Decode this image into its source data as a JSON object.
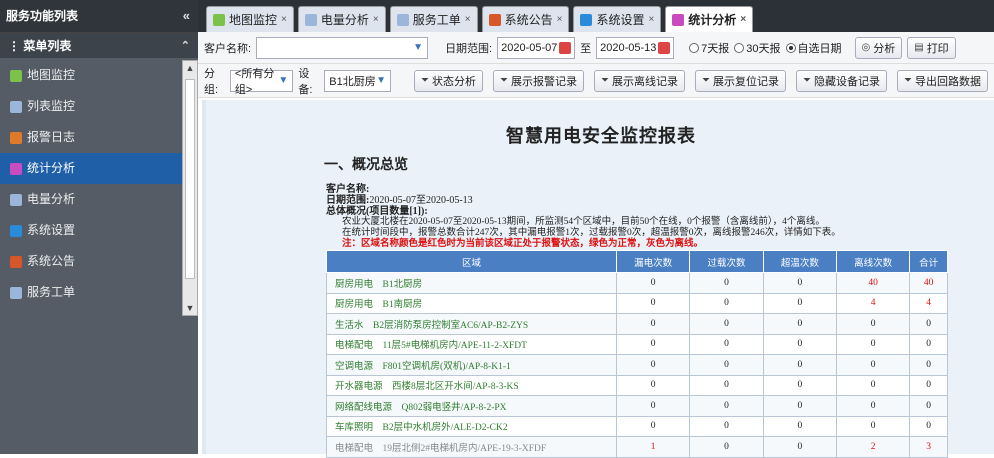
{
  "left": {
    "title": "服务功能列表",
    "collapse": "«",
    "menu_head": "菜单列表",
    "menu_toggle": "⌃",
    "items": [
      {
        "label": "地图监控",
        "icon": "map-icon",
        "color": "#7cc24a"
      },
      {
        "label": "列表监控",
        "icon": "list-icon",
        "color": "#9bb6d8"
      },
      {
        "label": "报警日志",
        "icon": "alarm-log-icon",
        "color": "#e07a2a"
      },
      {
        "label": "统计分析",
        "icon": "statistics-icon",
        "color": "#c84cc0",
        "active": true
      },
      {
        "label": "电量分析",
        "icon": "power-icon",
        "color": "#9bb6d8"
      },
      {
        "label": "系统设置",
        "icon": "settings-icon",
        "color": "#2a8bd8"
      },
      {
        "label": "系统公告",
        "icon": "notice-icon",
        "color": "#d8572a"
      },
      {
        "label": "服务工单",
        "icon": "workorder-icon",
        "color": "#9bb6d8"
      }
    ]
  },
  "tabs": [
    {
      "label": "地图监控",
      "icon": "map-icon",
      "color": "#7cc24a"
    },
    {
      "label": "电量分析",
      "icon": "power-icon",
      "color": "#9bb6d8"
    },
    {
      "label": "服务工单",
      "icon": "workorder-icon",
      "color": "#9bb6d8"
    },
    {
      "label": "系统公告",
      "icon": "notice-icon",
      "color": "#d8572a"
    },
    {
      "label": "系统设置",
      "icon": "settings-icon",
      "color": "#2a8bd8"
    },
    {
      "label": "统计分析",
      "icon": "statistics-icon",
      "color": "#c84cc0",
      "active": true
    }
  ],
  "toolbar1": {
    "customer_label": "客户名称:",
    "date_label": "日期范围:",
    "date_from": "2020-05-07",
    "date_to_sep": "至",
    "date_to": "2020-05-13",
    "radio_7": "7天报",
    "radio_30": "30天报",
    "radio_custom": "自选日期",
    "analyze": "分析",
    "print": "打印"
  },
  "toolbar2": {
    "group_label": "分组:",
    "group_value": "<所有分组>",
    "device_label": "设备:",
    "device_value": "B1北厨房",
    "buttons": [
      "状态分析",
      "展示报警记录",
      "展示离线记录",
      "展示复位记录",
      "隐藏设备记录",
      "导出回路数据"
    ]
  },
  "report": {
    "title": "智慧用电安全监控报表",
    "section": "一、概况总览",
    "customer_label": "客户名称:",
    "date_range_label": "日期范围:",
    "date_range": "2020-05-07至2020-05-13",
    "summary_label": "总体概况(项目数量[1]):",
    "line1": "农业大厦北楼在2020-05-07至2020-05-13期间，所监测54个区域中，目前50个在线，0个报警（含离线前），4个离线。",
    "line2": "在统计时间段中，报警总数合计247次，其中漏电报警1次，过载报警0次，超温报警0次，离线报警246次，详情如下表。",
    "warning": "注：区域名称颜色是红色时为当前该区域正处于报警状态，绿色为正常，灰色为离线。"
  },
  "table": {
    "headers": [
      "区域",
      "漏电次数",
      "过载次数",
      "超温次数",
      "离线次数",
      "合计"
    ],
    "rows": [
      {
        "area": "厨房用电　B1北厨房",
        "v": [
          "0",
          "0",
          "0",
          "40",
          "40"
        ],
        "red": [
          false,
          false,
          false,
          true,
          true
        ]
      },
      {
        "area": "厨房用电　B1南厨房",
        "v": [
          "0",
          "0",
          "0",
          "4",
          "4"
        ],
        "red": [
          false,
          false,
          false,
          true,
          true
        ]
      },
      {
        "area": "生活水　B2层消防泵房控制室AC6/AP-B2-ZYS",
        "v": [
          "0",
          "0",
          "0",
          "0",
          "0"
        ],
        "red": [
          false,
          false,
          false,
          false,
          false
        ]
      },
      {
        "area": "电梯配电　11层5#电梯机房内/APE-11-2-XFDT",
        "v": [
          "0",
          "0",
          "0",
          "0",
          "0"
        ],
        "red": [
          false,
          false,
          false,
          false,
          false
        ]
      },
      {
        "area": "空调电源　F801空调机房(双机)/AP-8-K1-1",
        "v": [
          "0",
          "0",
          "0",
          "0",
          "0"
        ],
        "red": [
          false,
          false,
          false,
          false,
          false
        ]
      },
      {
        "area": "开水器电源　西楼8层北区开水间/AP-8-3-KS",
        "v": [
          "0",
          "0",
          "0",
          "0",
          "0"
        ],
        "red": [
          false,
          false,
          false,
          false,
          false
        ]
      },
      {
        "area": "网络配线电源　Q802弱电竖井/AP-8-2-PX",
        "v": [
          "0",
          "0",
          "0",
          "0",
          "0"
        ],
        "red": [
          false,
          false,
          false,
          false,
          false
        ]
      },
      {
        "area": "车库照明　B2层中水机房外/ALE-D2-CK2",
        "v": [
          "0",
          "0",
          "0",
          "0",
          "0"
        ],
        "red": [
          false,
          false,
          false,
          false,
          false
        ]
      },
      {
        "area": "电梯配电　19层北侧2#电梯机房内/APE-19-3-XFDF",
        "v": [
          "1",
          "0",
          "0",
          "2",
          "3"
        ],
        "red": [
          true,
          false,
          false,
          true,
          true
        ],
        "grey": true
      }
    ]
  }
}
